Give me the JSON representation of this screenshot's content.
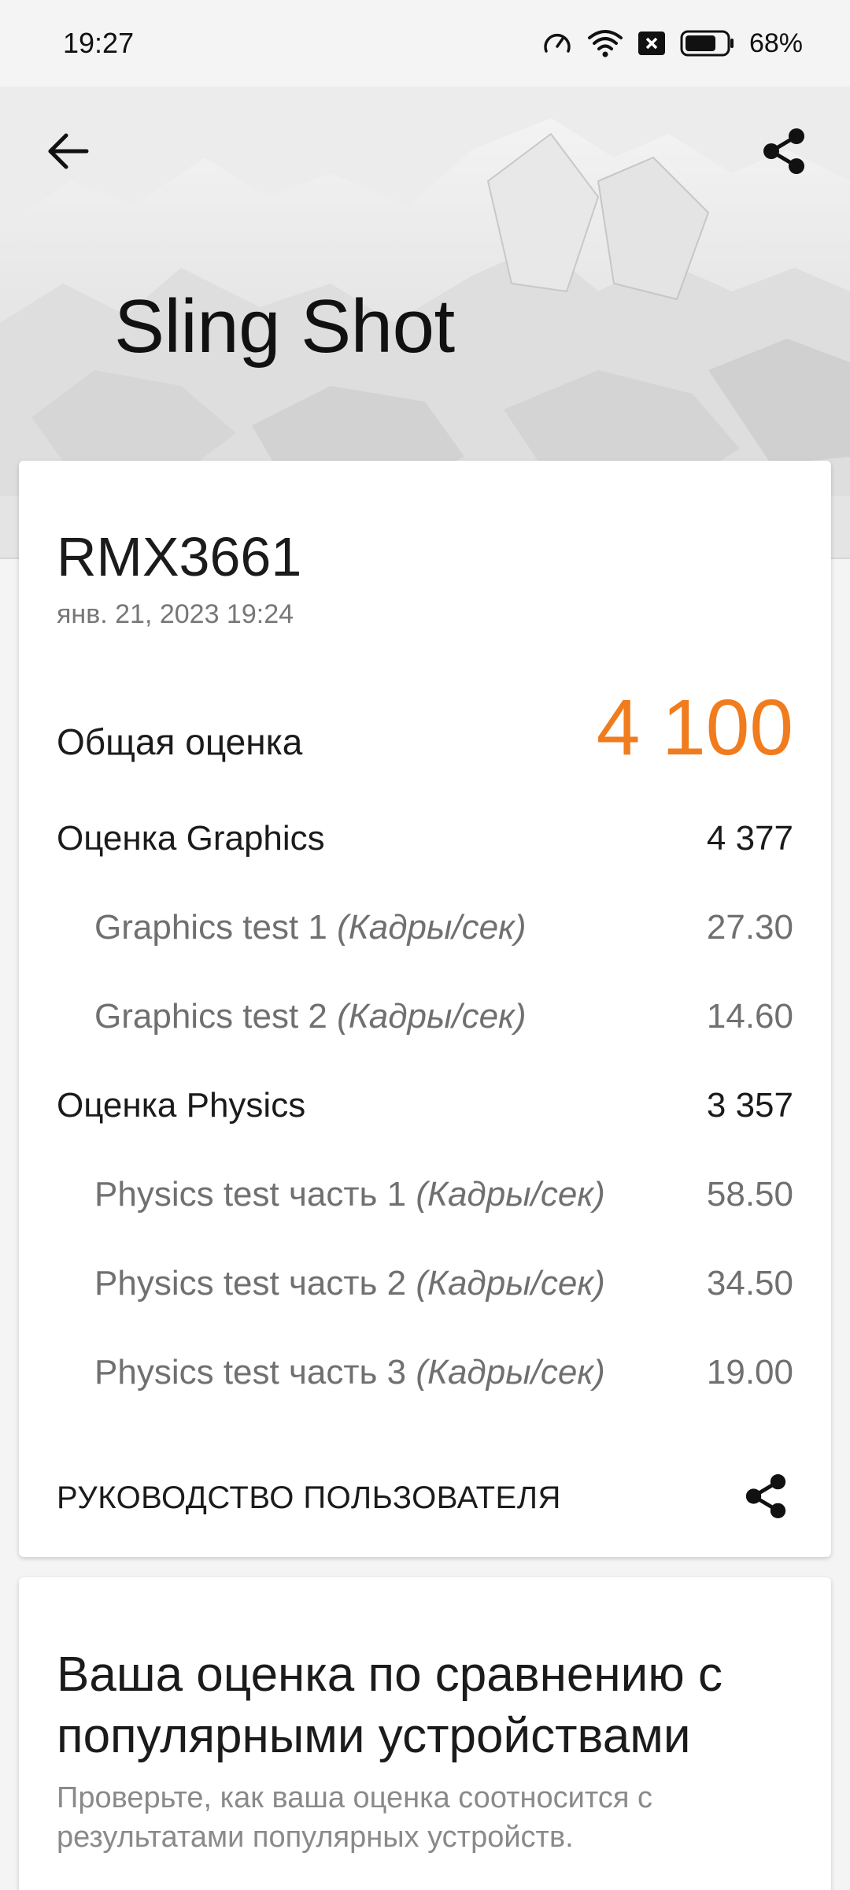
{
  "status_bar": {
    "time": "19:27",
    "battery_percent": "68%",
    "icons": [
      "speedometer-icon",
      "wifi-icon",
      "notification-x-icon",
      "battery-icon"
    ]
  },
  "header": {
    "title": "Sling Shot",
    "back_icon": "arrow-left-icon",
    "share_icon": "share-icon"
  },
  "result": {
    "device": "RMX3661",
    "date": "янв. 21, 2023 19:24",
    "overall_label": "Общая оценка",
    "overall_value": "4 100",
    "accent_color": "#f07c1e",
    "rows": [
      {
        "label": "Оценка Graphics",
        "unit": "",
        "value": "4 377"
      },
      {
        "label": "Graphics test 1",
        "unit": "(Кадры/сек)",
        "value": "27.30"
      },
      {
        "label": "Graphics test 2",
        "unit": "(Кадры/сек)",
        "value": "14.60"
      },
      {
        "label": "Оценка Physics",
        "unit": "",
        "value": "3 357"
      },
      {
        "label": "Physics test часть 1",
        "unit": "(Кадры/сек)",
        "value": "58.50"
      },
      {
        "label": "Physics test часть 2",
        "unit": "(Кадры/сек)",
        "value": "34.50"
      },
      {
        "label": "Physics test часть 3",
        "unit": "(Кадры/сек)",
        "value": "19.00"
      }
    ],
    "guide_label": "РУКОВОДСТВО ПОЛЬЗОВАТЕЛЯ"
  },
  "compare": {
    "title": "Ваша оценка по сравнению с популярными устройствами",
    "description": "Проверьте, как ваша оценка соотносится с результатами популярных устройств."
  }
}
